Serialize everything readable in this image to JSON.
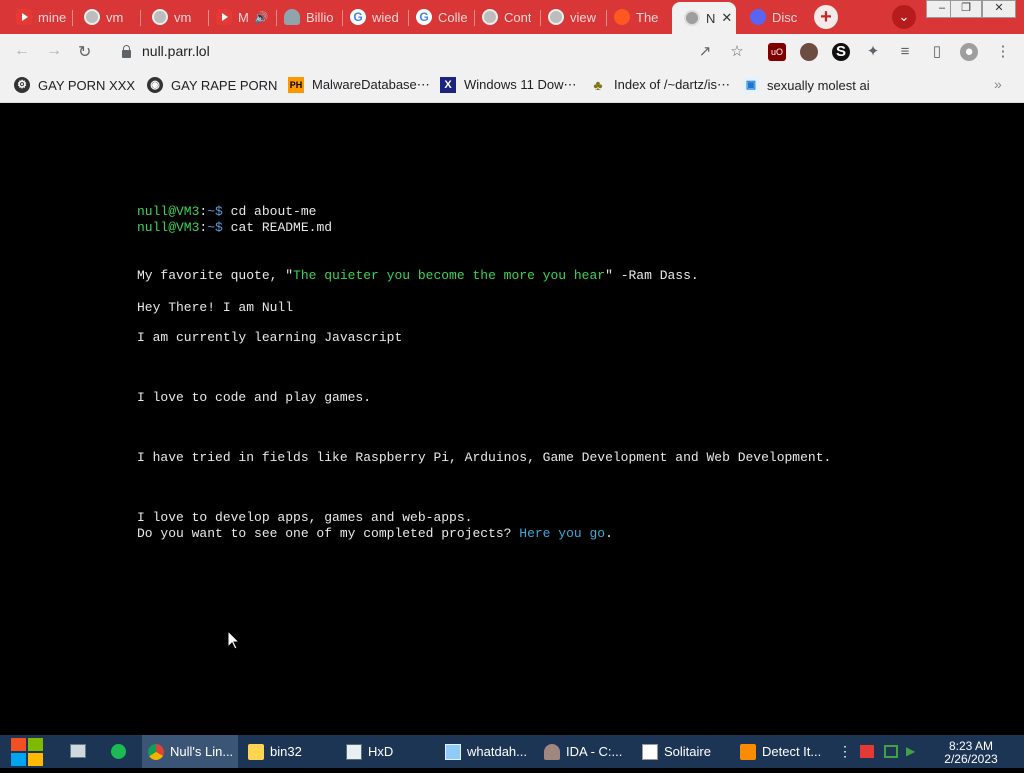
{
  "tabs": [
    {
      "label": "mine",
      "icon": "youtube-icon"
    },
    {
      "label": "vm",
      "icon": "globe-icon"
    },
    {
      "label": "vm",
      "icon": "globe-icon"
    },
    {
      "label": "M",
      "icon": "youtube-icon"
    },
    {
      "label": "Billio",
      "icon": "cloud-icon"
    },
    {
      "label": "wied",
      "icon": "google-icon"
    },
    {
      "label": "Colle",
      "icon": "google-icon"
    },
    {
      "label": "Cont",
      "icon": "globe-icon"
    },
    {
      "label": "view",
      "icon": "globe-icon"
    },
    {
      "label": "The",
      "icon": "reddit-icon"
    },
    {
      "label": "N",
      "icon": "globe-icon",
      "active": true
    },
    {
      "label": "Disc",
      "icon": "discord-icon"
    }
  ],
  "address": {
    "url": "null.parr.lol"
  },
  "bookmarks": [
    {
      "label": "GAY PORN XXX",
      "icon": "bookmark-site-icon"
    },
    {
      "label": "GAY RAPE PORN",
      "icon": "bookmark-site-icon"
    },
    {
      "label": "MalwareDatabase⋯",
      "icon": "ph-icon",
      "icon_text": "PH"
    },
    {
      "label": "Windows 11 Dow⋯",
      "icon": "x-icon",
      "icon_text": "X"
    },
    {
      "label": "Index of /~dartz/is⋯",
      "icon": "tree-icon"
    },
    {
      "label": "sexually molest ai",
      "icon": "bookmark-site-icon"
    }
  ],
  "terminal": {
    "prompt_user": "null@VM3",
    "prompt_sep": ":",
    "prompt_path": "~$",
    "cmd1": " cd about-me",
    "cmd2": " cat README.md",
    "quote_prefix": "My favorite quote, \"",
    "quote_text": "The quieter you become the more you hear",
    "quote_suffix": "\" -Ram Dass.",
    "line_hey": "Hey There! I am Null",
    "line_learning": "I am currently learning Javascript",
    "line_love_code": "I love to code and play games.",
    "line_fields": "I have tried in fields like Raspberry Pi, Arduinos, Game Development and Web Development.",
    "line_develop": "I love to develop apps, games and web-apps.",
    "line_projects_prefix": "Do you want to see one of my completed projects? ",
    "line_projects_link": "Here you go",
    "line_projects_suffix": "."
  },
  "taskbar": {
    "items": [
      {
        "label": "Null's Lin...",
        "icon": "chrome-icon",
        "active": true
      },
      {
        "label": "bin32",
        "icon": "folder-icon"
      },
      {
        "label": "HxD",
        "icon": "hxd-icon"
      },
      {
        "label": "whatdah...",
        "icon": "image-viewer-icon"
      },
      {
        "label": "IDA - C:...",
        "icon": "ida-icon"
      },
      {
        "label": "Solitaire",
        "icon": "solitaire-icon"
      },
      {
        "label": "Detect It...",
        "icon": "detect-it-easy-icon"
      }
    ],
    "time": "8:23 AM",
    "date": "2/26/2023"
  },
  "colors": {
    "tab_strip": "#d93737",
    "taskbar": "#1d3554",
    "prompt_green": "#39d353",
    "link_blue": "#3ea8d8"
  }
}
